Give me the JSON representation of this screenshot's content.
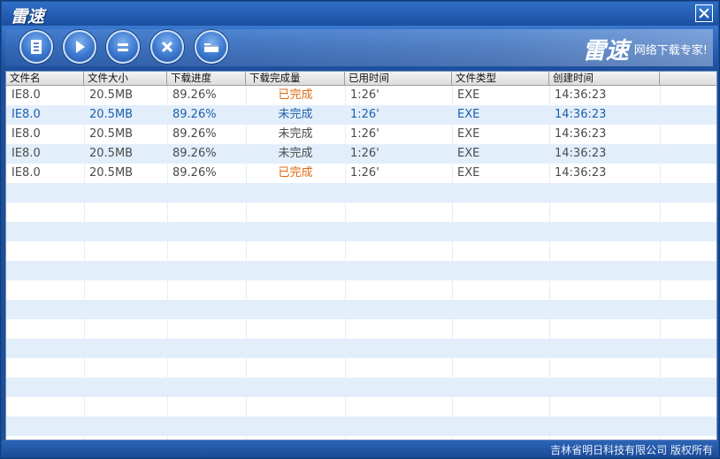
{
  "window": {
    "title_logo": "雷速"
  },
  "toolbar": {
    "buttons": [
      {
        "name": "list-button",
        "icon": "list-icon"
      },
      {
        "name": "start-button",
        "icon": "play-icon"
      },
      {
        "name": "pause-button",
        "icon": "pause-icon"
      },
      {
        "name": "delete-button",
        "icon": "x-icon"
      },
      {
        "name": "folder-button",
        "icon": "folder-icon"
      }
    ],
    "brand_logo": "雷速",
    "brand_slogan": "网络下载专家!"
  },
  "table": {
    "columns": [
      "文件名",
      "文件大小",
      "下载进度",
      "下载完成量",
      "已用时间",
      "文件类型",
      "创建时间"
    ],
    "rows": [
      {
        "name": "IE8.0",
        "size": "20.5MB",
        "progress": "89.26%",
        "status": "已完成",
        "elapsed": "1:26'",
        "type": "EXE",
        "created": "14:36:23",
        "status_color": "#e06a10"
      },
      {
        "name": "IE8.0",
        "size": "20.5MB",
        "progress": "89.26%",
        "status": "未完成",
        "elapsed": "1:26'",
        "type": "EXE",
        "created": "14:36:23",
        "selected": true
      },
      {
        "name": "IE8.0",
        "size": "20.5MB",
        "progress": "89.26%",
        "status": "未完成",
        "elapsed": "1:26'",
        "type": "EXE",
        "created": "14:36:23"
      },
      {
        "name": "IE8.0",
        "size": "20.5MB",
        "progress": "89.26%",
        "status": "未完成",
        "elapsed": "1:26'",
        "type": "EXE",
        "created": "14:36:23"
      },
      {
        "name": "IE8.0",
        "size": "20.5MB",
        "progress": "89.26%",
        "status": "已完成",
        "elapsed": "1:26'",
        "type": "EXE",
        "created": "14:36:23",
        "status_color": "#e06a10"
      }
    ]
  },
  "statusbar": {
    "copyright": "吉林省明日科技有限公司 版权所有"
  },
  "colors": {
    "accent": "#1c4f99",
    "selected_text": "#1d5fa8",
    "done_text": "#e06a10",
    "alt_row": "#e3eefb"
  }
}
